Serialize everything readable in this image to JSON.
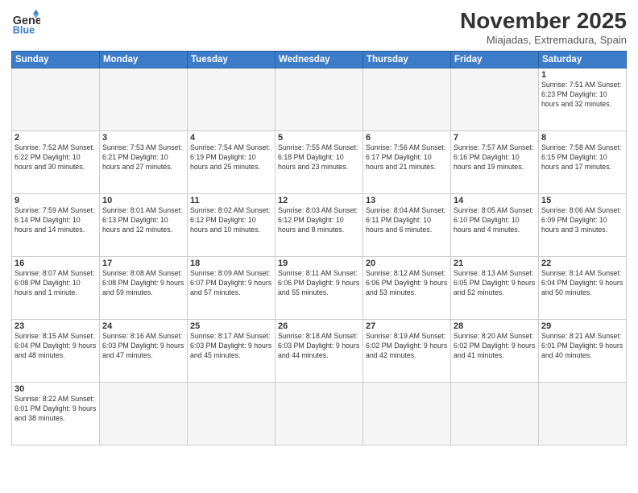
{
  "header": {
    "logo_line1": "General",
    "logo_line2": "Blue",
    "month": "November 2025",
    "location": "Miajadas, Extremadura, Spain"
  },
  "weekdays": [
    "Sunday",
    "Monday",
    "Tuesday",
    "Wednesday",
    "Thursday",
    "Friday",
    "Saturday"
  ],
  "weeks": [
    [
      {
        "day": "",
        "text": ""
      },
      {
        "day": "",
        "text": ""
      },
      {
        "day": "",
        "text": ""
      },
      {
        "day": "",
        "text": ""
      },
      {
        "day": "",
        "text": ""
      },
      {
        "day": "",
        "text": ""
      },
      {
        "day": "1",
        "text": "Sunrise: 7:51 AM\nSunset: 6:23 PM\nDaylight: 10 hours\nand 32 minutes."
      }
    ],
    [
      {
        "day": "2",
        "text": "Sunrise: 7:52 AM\nSunset: 6:22 PM\nDaylight: 10 hours\nand 30 minutes."
      },
      {
        "day": "3",
        "text": "Sunrise: 7:53 AM\nSunset: 6:21 PM\nDaylight: 10 hours\nand 27 minutes."
      },
      {
        "day": "4",
        "text": "Sunrise: 7:54 AM\nSunset: 6:19 PM\nDaylight: 10 hours\nand 25 minutes."
      },
      {
        "day": "5",
        "text": "Sunrise: 7:55 AM\nSunset: 6:18 PM\nDaylight: 10 hours\nand 23 minutes."
      },
      {
        "day": "6",
        "text": "Sunrise: 7:56 AM\nSunset: 6:17 PM\nDaylight: 10 hours\nand 21 minutes."
      },
      {
        "day": "7",
        "text": "Sunrise: 7:57 AM\nSunset: 6:16 PM\nDaylight: 10 hours\nand 19 minutes."
      },
      {
        "day": "8",
        "text": "Sunrise: 7:58 AM\nSunset: 6:15 PM\nDaylight: 10 hours\nand 17 minutes."
      }
    ],
    [
      {
        "day": "9",
        "text": "Sunrise: 7:59 AM\nSunset: 6:14 PM\nDaylight: 10 hours\nand 14 minutes."
      },
      {
        "day": "10",
        "text": "Sunrise: 8:01 AM\nSunset: 6:13 PM\nDaylight: 10 hours\nand 12 minutes."
      },
      {
        "day": "11",
        "text": "Sunrise: 8:02 AM\nSunset: 6:12 PM\nDaylight: 10 hours\nand 10 minutes."
      },
      {
        "day": "12",
        "text": "Sunrise: 8:03 AM\nSunset: 6:12 PM\nDaylight: 10 hours\nand 8 minutes."
      },
      {
        "day": "13",
        "text": "Sunrise: 8:04 AM\nSunset: 6:11 PM\nDaylight: 10 hours\nand 6 minutes."
      },
      {
        "day": "14",
        "text": "Sunrise: 8:05 AM\nSunset: 6:10 PM\nDaylight: 10 hours\nand 4 minutes."
      },
      {
        "day": "15",
        "text": "Sunrise: 8:06 AM\nSunset: 6:09 PM\nDaylight: 10 hours\nand 3 minutes."
      }
    ],
    [
      {
        "day": "16",
        "text": "Sunrise: 8:07 AM\nSunset: 6:08 PM\nDaylight: 10 hours\nand 1 minute."
      },
      {
        "day": "17",
        "text": "Sunrise: 8:08 AM\nSunset: 6:08 PM\nDaylight: 9 hours\nand 59 minutes."
      },
      {
        "day": "18",
        "text": "Sunrise: 8:09 AM\nSunset: 6:07 PM\nDaylight: 9 hours\nand 57 minutes."
      },
      {
        "day": "19",
        "text": "Sunrise: 8:11 AM\nSunset: 6:06 PM\nDaylight: 9 hours\nand 55 minutes."
      },
      {
        "day": "20",
        "text": "Sunrise: 8:12 AM\nSunset: 6:06 PM\nDaylight: 9 hours\nand 53 minutes."
      },
      {
        "day": "21",
        "text": "Sunrise: 8:13 AM\nSunset: 6:05 PM\nDaylight: 9 hours\nand 52 minutes."
      },
      {
        "day": "22",
        "text": "Sunrise: 8:14 AM\nSunset: 6:04 PM\nDaylight: 9 hours\nand 50 minutes."
      }
    ],
    [
      {
        "day": "23",
        "text": "Sunrise: 8:15 AM\nSunset: 6:04 PM\nDaylight: 9 hours\nand 48 minutes."
      },
      {
        "day": "24",
        "text": "Sunrise: 8:16 AM\nSunset: 6:03 PM\nDaylight: 9 hours\nand 47 minutes."
      },
      {
        "day": "25",
        "text": "Sunrise: 8:17 AM\nSunset: 6:03 PM\nDaylight: 9 hours\nand 45 minutes."
      },
      {
        "day": "26",
        "text": "Sunrise: 8:18 AM\nSunset: 6:03 PM\nDaylight: 9 hours\nand 44 minutes."
      },
      {
        "day": "27",
        "text": "Sunrise: 8:19 AM\nSunset: 6:02 PM\nDaylight: 9 hours\nand 42 minutes."
      },
      {
        "day": "28",
        "text": "Sunrise: 8:20 AM\nSunset: 6:02 PM\nDaylight: 9 hours\nand 41 minutes."
      },
      {
        "day": "29",
        "text": "Sunrise: 8:21 AM\nSunset: 6:01 PM\nDaylight: 9 hours\nand 40 minutes."
      }
    ],
    [
      {
        "day": "30",
        "text": "Sunrise: 8:22 AM\nSunset: 6:01 PM\nDaylight: 9 hours\nand 38 minutes."
      },
      {
        "day": "",
        "text": ""
      },
      {
        "day": "",
        "text": ""
      },
      {
        "day": "",
        "text": ""
      },
      {
        "day": "",
        "text": ""
      },
      {
        "day": "",
        "text": ""
      },
      {
        "day": "",
        "text": ""
      }
    ]
  ]
}
